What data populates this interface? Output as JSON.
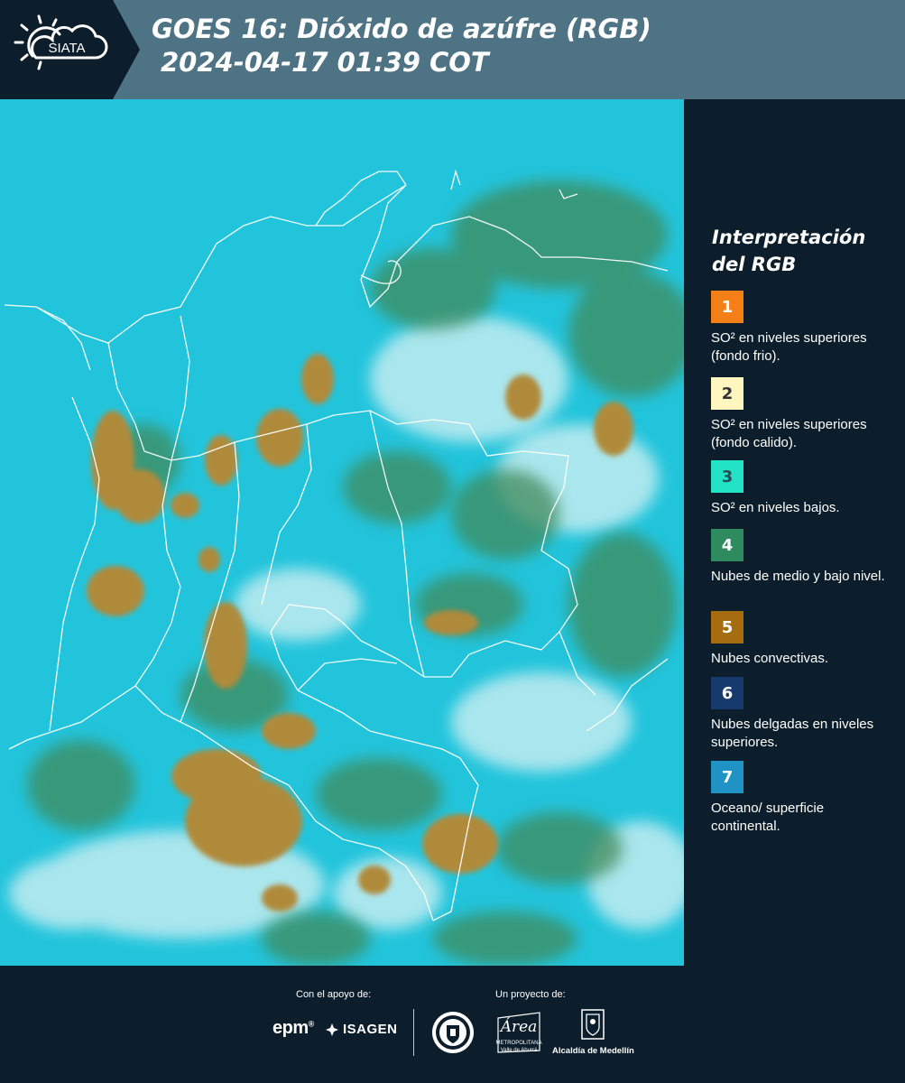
{
  "header": {
    "logo_text": "SIATA",
    "title_line1": "GOES 16: Dióxido de azúfre (RGB)",
    "title_line2": "2024-04-17 01:39 COT"
  },
  "legend": {
    "title": "Interpretación del RGB",
    "items": [
      {
        "number": "1",
        "color": "#f57f17",
        "text": "SO² en niveles superiores (fondo frio)."
      },
      {
        "number": "2",
        "color": "#fff6c0",
        "text": "SO² en niveles superiores (fondo calido)."
      },
      {
        "number": "3",
        "color": "#22e3c6",
        "text": "SO² en niveles bajos."
      },
      {
        "number": "4",
        "color": "#2e8b60",
        "text": "Nubes de medio y bajo nivel."
      },
      {
        "number": "5",
        "color": "#a66c10",
        "text": "Nubes convectivas."
      },
      {
        "number": "6",
        "color": "#163a6e",
        "text": "Nubes delgadas en niveles superiores."
      },
      {
        "number": "7",
        "color": "#1e93c4",
        "text": "Oceano/ superficie continental."
      }
    ]
  },
  "map_colors": {
    "ocean": "#22c4dc",
    "cloud_high": "#b9e8ec",
    "cloud_mid": "#3f8a5a",
    "convective": "#b08a3a",
    "borders": "#ffffff"
  },
  "footer": {
    "support_label": "Con el apoyo de:",
    "project_label": "Un proyecto de:",
    "sponsor_1": "epm",
    "sponsor_2": "ISAGEN",
    "area_logo_word": "Área",
    "area_logo_sub": "METROPOLITANA Valle de Aburrá",
    "alcaldia": "Alcaldía de Medellín"
  },
  "icons": [
    "siata-sun-cloud-icon",
    "isagen-flame-icon",
    "medellin-seal-icon",
    "alcaldia-shield-icon"
  ]
}
